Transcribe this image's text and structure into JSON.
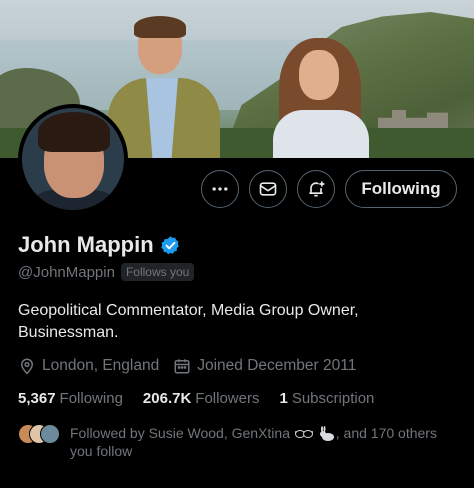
{
  "profile": {
    "name": "John Mappin",
    "handle": "@JohnMappin",
    "follows_you": "Follows you",
    "bio_line1": "Geopolitical Commentator, Media Group Owner,",
    "bio_line2": "Businessman.",
    "location": "London, England",
    "joined": "Joined December 2011",
    "verified_color": "#1d9bf0"
  },
  "stats": {
    "following_count": "5,367",
    "following_label": "Following",
    "followers_count": "206.7K",
    "followers_label": "Followers",
    "subscription_count": "1",
    "subscription_label": "Subscription"
  },
  "actions": {
    "more_icon": "more-icon",
    "message_icon": "mail-icon",
    "notify_icon": "bell-plus-icon",
    "follow_label": "Following"
  },
  "followed_by": {
    "prefix": "Followed by Susie Wood, GenXtina",
    "suffix": ", and 170 others",
    "line2": "you follow"
  },
  "colors": {
    "background": "#000000",
    "text": "#e7e9ea",
    "muted": "#71767b",
    "border": "#536471"
  }
}
